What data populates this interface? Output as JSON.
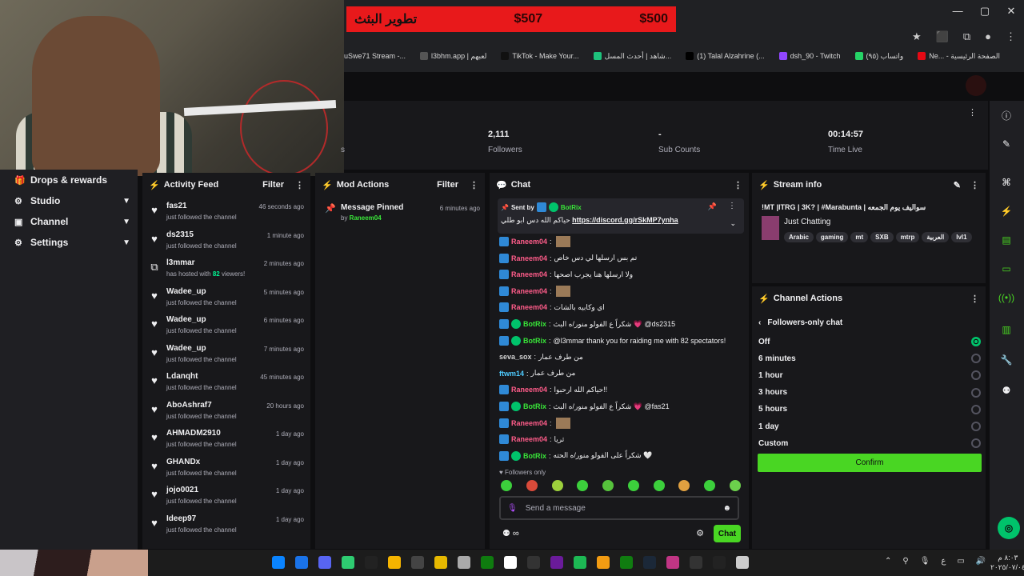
{
  "donation_bar": {
    "title": "تطوير البثث",
    "left_amount": "$507",
    "right_amount": "$500"
  },
  "window_controls": [
    "—",
    "▢",
    "✕"
  ],
  "bookmarks": [
    {
      "label": "uSwe71 Stream -...",
      "color": "#555"
    },
    {
      "label": "l3bhm.app | لعبهم",
      "color": "#555"
    },
    {
      "label": "TikTok - Make Your...",
      "color": "#111"
    },
    {
      "label": "شاهد | أحدث المسل...",
      "color": "#1ec27c"
    },
    {
      "label": "(1) Talal Alzahrine (...",
      "color": "#000"
    },
    {
      "label": "dsh_90 - Twitch",
      "color": "#9146ff"
    },
    {
      "label": "واتساب (٩٥)",
      "color": "#25d366"
    },
    {
      "label": "Ne... - الصفحة الرئيسية",
      "color": "#e50914"
    }
  ],
  "stats": [
    {
      "value": "2,111",
      "label": "Followers"
    },
    {
      "value": "-",
      "label": "Sub Counts"
    },
    {
      "value": "00:14:57",
      "label": "Time Live"
    }
  ],
  "stats_partial_label": "s",
  "nav": [
    {
      "label": "Drops & rewards",
      "icon": "gift-icon"
    },
    {
      "label": "Studio",
      "icon": "studio-icon"
    },
    {
      "label": "Channel",
      "icon": "channel-icon"
    },
    {
      "label": "Settings",
      "icon": "gear-icon"
    }
  ],
  "activity": {
    "title": "Activity Feed",
    "filter": "Filter",
    "items": [
      {
        "name": "fas21",
        "sub": "just followed the channel",
        "time": "46 seconds ago"
      },
      {
        "name": "ds2315",
        "sub": "just followed the channel",
        "time": "1 minute ago"
      },
      {
        "name": "l3mmar",
        "sub_pre": "has hosted with ",
        "sub_num": "82",
        "sub_post": " viewers!",
        "time": "2 minutes ago",
        "host": true
      },
      {
        "name": "Wadee_up",
        "sub": "just followed the channel",
        "time": "5 minutes ago"
      },
      {
        "name": "Wadee_up",
        "sub": "just followed the channel",
        "time": "6 minutes ago"
      },
      {
        "name": "Wadee_up",
        "sub": "just followed the channel",
        "time": "7 minutes ago"
      },
      {
        "name": "Ldanqht",
        "sub": "just followed the channel",
        "time": "45 minutes ago"
      },
      {
        "name": "AboAshraf7",
        "sub": "just followed the channel",
        "time": "20 hours ago"
      },
      {
        "name": "AHMADM2910",
        "sub": "just followed the channel",
        "time": "1 day ago"
      },
      {
        "name": "GHANDx",
        "sub": "just followed the channel",
        "time": "1 day ago"
      },
      {
        "name": "jojo0021",
        "sub": "just followed the channel",
        "time": "1 day ago"
      },
      {
        "name": "Ideep97",
        "sub": "just followed the channel",
        "time": "1 day ago"
      }
    ]
  },
  "mod_actions": {
    "title": "Mod Actions",
    "filter": "Filter",
    "item": {
      "title": "Message Pinned",
      "by": "by ",
      "user": "Raneem04",
      "time": "6 minutes ago"
    }
  },
  "chat": {
    "title": "Chat",
    "pinned": {
      "sent_by": "Sent by",
      "user": "BotRix",
      "text": "حياكم الله دس ابو طلي",
      "link": "https://discord.gg/rSkMP7ynha"
    },
    "messages": [
      {
        "user": "Raneem04",
        "color": "pink",
        "text": "",
        "thumb": true
      },
      {
        "user": "Raneem04",
        "color": "pink",
        "text": "تم بس ارسلها لي دس خاص"
      },
      {
        "user": "Raneem04",
        "color": "pink",
        "text": "ولا ارسلها هنا يجرب اصحها"
      },
      {
        "user": "Raneem04",
        "color": "pink",
        "text": "",
        "thumb": true
      },
      {
        "user": "Raneem04",
        "color": "pink",
        "text": "اي وكابيه بالشات"
      },
      {
        "user": "BotRix",
        "color": "green",
        "verified": true,
        "text": "شكراً ع الفولو منور/ه البث 💗 @ds2315"
      },
      {
        "user": "BotRix",
        "color": "green",
        "verified": true,
        "text": "@l3mmar thank you for raiding me with 82 spectators!"
      },
      {
        "user": "seva_sox",
        "color": "grey",
        "nobadge": true,
        "text": "من طرف عمار"
      },
      {
        "user": "ftwm14",
        "color": "blue",
        "nobadge": true,
        "text": "من طرف عمار"
      },
      {
        "user": "Raneem04",
        "color": "pink",
        "text": "حياكم الله ارحبوا!!"
      },
      {
        "user": "BotRix",
        "color": "green",
        "verified": true,
        "text": "شكراً ع الفولو منور/ه البث 💗 @fas21"
      },
      {
        "user": "Raneem04",
        "color": "pink",
        "text": "",
        "thumb": true
      },
      {
        "user": "Raneem04",
        "color": "pink",
        "text": "ثريا"
      },
      {
        "user": "BotRix",
        "color": "green",
        "verified": true,
        "text": "شكراً على الفولو منور/ه الحته 🤍"
      }
    ],
    "followers_only": "Followers only",
    "placeholder": "Send a message",
    "send_label": "Chat"
  },
  "stream_info": {
    "title": "Stream info",
    "stream_title": "!MT |ITRG | 3K? | #Marabunta | سواليف يوم الجمعه",
    "category": "Just Chatting",
    "tags": [
      "Arabic",
      "gaming",
      "mt",
      "SXB",
      "mtrp",
      "العربية",
      "lvl1"
    ]
  },
  "channel_actions": {
    "title": "Channel Actions",
    "subtitle": "Followers-only chat",
    "options": [
      "Off",
      "6 minutes",
      "1 hour",
      "3 hours",
      "5 hours",
      "1 day",
      "Custom"
    ],
    "selected": "Off",
    "confirm": "Confirm"
  },
  "clock": {
    "time": "٨:٠٣ م",
    "date": "٢٠٢٥/٠٧/٠٤"
  },
  "tray_lang": "ع",
  "colors": {
    "accent": "#49d623",
    "pink": "#ff5c8a",
    "green": "#39e639",
    "blue": "#4ecbff"
  }
}
